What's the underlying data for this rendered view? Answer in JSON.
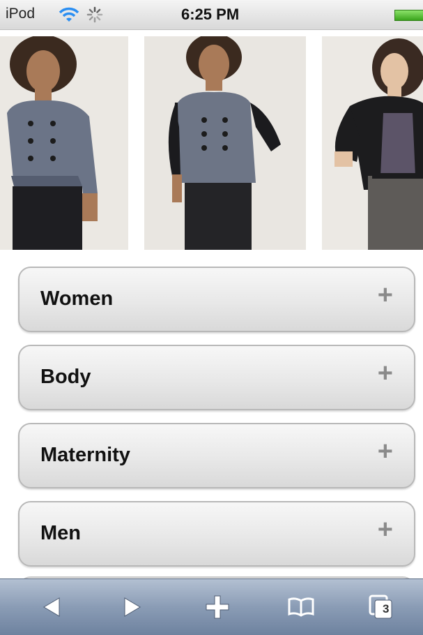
{
  "status_bar": {
    "carrier": "iPod",
    "time": "6:25 PM"
  },
  "carousel": {
    "photos": [
      "model-gray-jacket-photo",
      "model-colorblock-jacket-photo",
      "model-black-blazer-photo"
    ]
  },
  "categories": [
    {
      "label": "Women",
      "icon": "plus-icon"
    },
    {
      "label": "Body",
      "icon": "plus-icon"
    },
    {
      "label": "Maternity",
      "icon": "plus-icon"
    },
    {
      "label": "Men",
      "icon": "plus-icon"
    }
  ],
  "toolbar": {
    "tab_count": "3"
  },
  "colors": {
    "toolbar": "#8a9cb5",
    "button_border": "#b8b8b8",
    "plus": "#8a8a8a"
  }
}
